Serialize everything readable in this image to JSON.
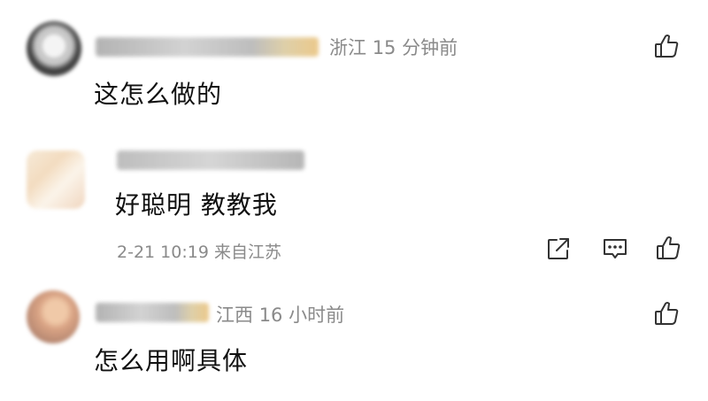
{
  "comments": [
    {
      "location": "浙江",
      "time": "15 分钟前",
      "text": "这怎么做的"
    },
    {
      "text": "好聪明 教教我",
      "date": "2-21 10:19",
      "source": "来自江苏"
    },
    {
      "location": "江西",
      "time": "16 小时前",
      "text": "怎么用啊具体"
    }
  ],
  "icons": {
    "like": "thumbs-up-icon",
    "share": "share-icon",
    "reply": "comment-icon"
  },
  "colors": {
    "meta": "#8a8a8a",
    "text": "#111111",
    "icon": "#333333"
  }
}
